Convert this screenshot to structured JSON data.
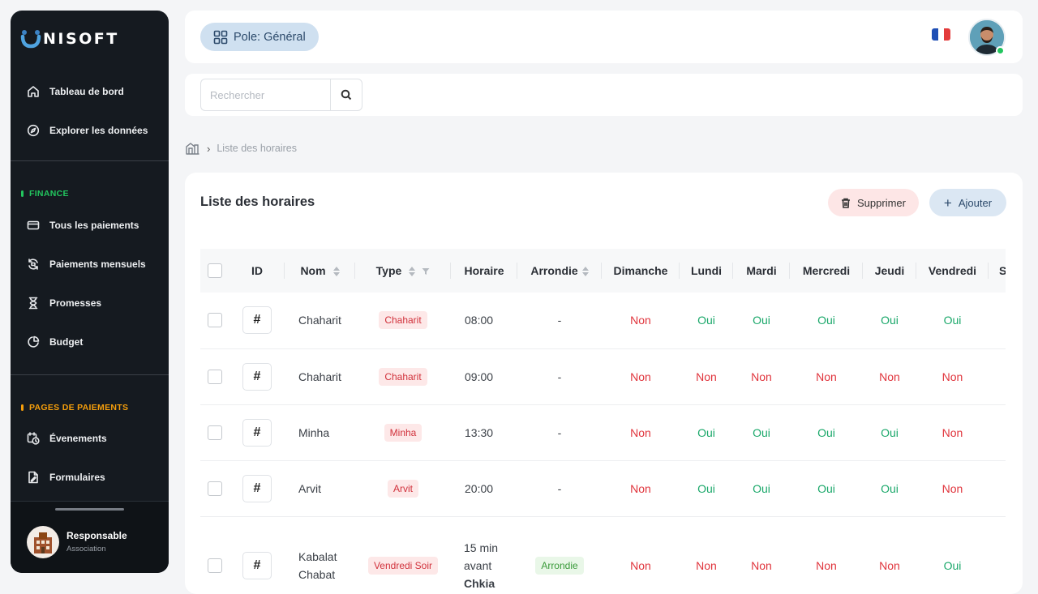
{
  "brand": {
    "logo_text": "NISOFT"
  },
  "sidebar": {
    "main_items": [
      {
        "label": "Tableau de bord",
        "icon": "home-icon"
      },
      {
        "label": "Explorer les données",
        "icon": "compass-icon"
      }
    ],
    "finance": {
      "title": "FINANCE",
      "accent": "#22c55e",
      "items": [
        {
          "label": "Tous les paiements",
          "icon": "credit-card-icon"
        },
        {
          "label": "Paiements mensuels",
          "icon": "refresh-icon"
        },
        {
          "label": "Promesses",
          "icon": "hourglass-icon"
        },
        {
          "label": "Budget",
          "icon": "pie-chart-icon"
        }
      ]
    },
    "pages": {
      "title": "PAGES DE PAIEMENTS",
      "accent": "#f59e0b",
      "items": [
        {
          "label": "Évenements",
          "icon": "calendar-clock-icon"
        },
        {
          "label": "Formulaires",
          "icon": "form-icon"
        }
      ]
    },
    "user": {
      "name": "Responsable",
      "role": "Association"
    }
  },
  "header": {
    "pole_label": "Pole: Général",
    "language": "fr"
  },
  "search": {
    "placeholder": "Rechercher",
    "value": ""
  },
  "breadcrumb": {
    "current": "Liste des horaires"
  },
  "card": {
    "title": "Liste des horaires",
    "delete_label": "Supprimer",
    "add_label": "Ajouter"
  },
  "table": {
    "columns": [
      "ID",
      "Nom",
      "Type",
      "Horaire",
      "Arrondie",
      "Dimanche",
      "Lundi",
      "Mardi",
      "Mercredi",
      "Jeudi",
      "Vendredi",
      "S"
    ],
    "id_symbol": "#",
    "rows": [
      {
        "nom": "Chaharit",
        "type": "Chaharit",
        "horaire": "08:00",
        "arrondie": "-",
        "days": [
          "Non",
          "Oui",
          "Oui",
          "Oui",
          "Oui",
          "Oui"
        ]
      },
      {
        "nom": "Chaharit",
        "type": "Chaharit",
        "horaire": "09:00",
        "arrondie": "-",
        "days": [
          "Non",
          "Non",
          "Non",
          "Non",
          "Non",
          "Non"
        ]
      },
      {
        "nom": "Minha",
        "type": "Minha",
        "horaire": "13:30",
        "arrondie": "-",
        "days": [
          "Non",
          "Oui",
          "Oui",
          "Oui",
          "Oui",
          "Non"
        ]
      },
      {
        "nom": "Arvit",
        "type": "Arvit",
        "horaire": "20:00",
        "arrondie": "-",
        "days": [
          "Non",
          "Oui",
          "Oui",
          "Oui",
          "Oui",
          "Non"
        ]
      },
      {
        "nom_line1": "Kabalat",
        "nom_line2": "Chabat",
        "type": "Vendredi Soir",
        "horaire_line1": "15 min",
        "horaire_line2": "avant",
        "horaire_line3": "Chkia",
        "arrondie": "Arrondie",
        "days": [
          "Non",
          "Non",
          "Non",
          "Non",
          "Non",
          "Oui"
        ]
      }
    ]
  }
}
